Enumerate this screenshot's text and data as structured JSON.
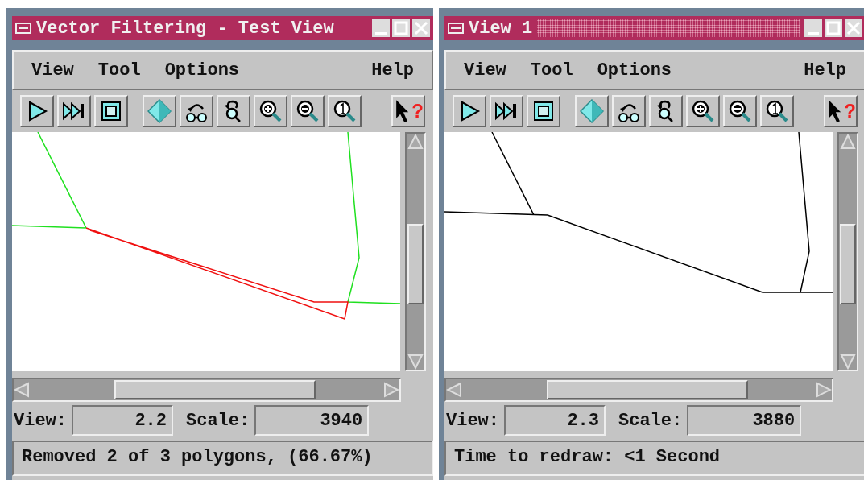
{
  "windows": [
    {
      "title": "Vector Filtering - Test View",
      "active": true,
      "menu": [
        {
          "label": "View",
          "kind": "menu"
        },
        {
          "label": "Tool",
          "kind": "menu"
        },
        {
          "label": "Options",
          "kind": "menu"
        },
        {
          "label": "Help",
          "kind": "help"
        }
      ],
      "help_glyph": "?",
      "canvas": {
        "kind": "filtered"
      },
      "view_label": "View:",
      "view_value": "2.2",
      "scale_label": "Scale:",
      "scale_value": "3940",
      "status": "Removed 2 of 3 polygons, (66.67%)"
    },
    {
      "title": "View 1",
      "active": false,
      "menu": [
        {
          "label": "View",
          "kind": "menu"
        },
        {
          "label": "Tool",
          "kind": "menu"
        },
        {
          "label": "Options",
          "kind": "menu"
        },
        {
          "label": "Help",
          "kind": "help"
        }
      ],
      "help_glyph": "?",
      "canvas": {
        "kind": "original"
      },
      "view_label": "View:",
      "view_value": "2.3",
      "scale_label": "Scale:",
      "scale_value": "3880",
      "status": "Time to redraw: <1 Second"
    }
  ]
}
